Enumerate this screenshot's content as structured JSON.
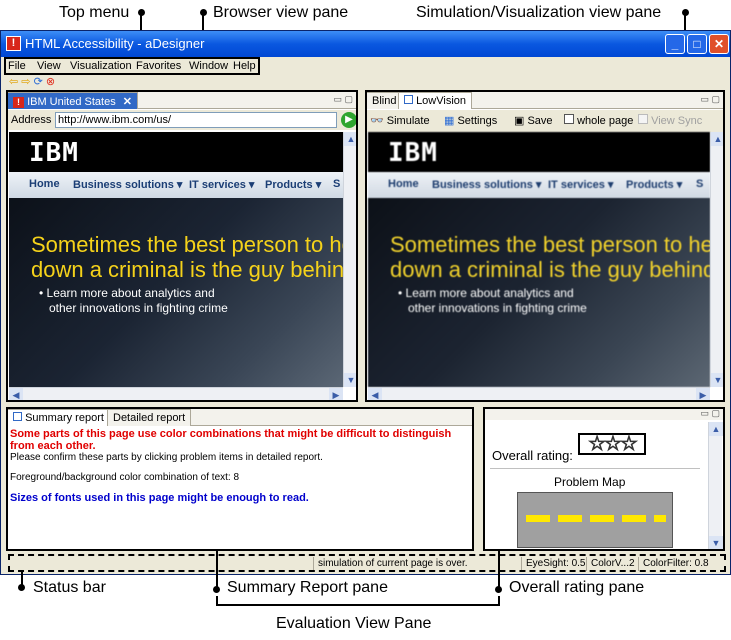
{
  "callouts": {
    "top_menu": "Top menu",
    "browser_view_pane": "Browser view pane",
    "simulation_view_pane": "Simulation/Visualization view pane",
    "status_bar": "Status bar",
    "summary_report_pane": "Summary Report pane",
    "overall_rating_pane": "Overall rating pane",
    "evaluation_view_pane": "Evaluation View Pane"
  },
  "window": {
    "title": "HTML Accessibility - aDesigner",
    "controls": {
      "minimize": "_",
      "maximize": "□",
      "close": "✕"
    }
  },
  "menu": [
    "File",
    "View",
    "Visualization",
    "Favorites",
    "Window",
    "Help"
  ],
  "browser": {
    "nav_icons": [
      "back-arrow-icon",
      "forward-arrow-icon",
      "refresh-icon",
      "stop-icon"
    ],
    "tab_label": "IBM United States",
    "tab_close": "✕",
    "address_label": "Address",
    "address_value": "http://www.ibm.com/us/",
    "go_icon": "go-icon"
  },
  "web_page": {
    "logo": "IBM",
    "nav": [
      "Home",
      "Business solutions ▾",
      "IT services ▾",
      "Products ▾",
      "S"
    ],
    "headline_line1": "Sometimes the best person to help",
    "headline_line2": "down a criminal is the guy behind t",
    "sub_line1": "• Learn more about analytics and",
    "sub_line2": "other innovations in fighting crime"
  },
  "simulation": {
    "tabs": [
      "Blind",
      "LowVision"
    ],
    "toolbar": {
      "simulate": "Simulate",
      "settings": "Settings",
      "save": "Save",
      "whole_page": "whole page",
      "view_sync": "View Sync"
    }
  },
  "report": {
    "tabs": [
      "Summary report",
      "Detailed report"
    ],
    "red_text": "Some parts of this page use color combinations that might be difficult to distinguish from each other.",
    "confirm_text": "Please confirm these parts by clicking problem items in detailed report.",
    "fg_bg_text": "Foreground/background color combination of text: 8",
    "blue_text": "Sizes of fonts used in this page might be enough to read."
  },
  "rating": {
    "label": "Overall rating:",
    "stars": 3,
    "stars_glyph": "☆☆☆",
    "problem_map": "Problem Map"
  },
  "status": {
    "message": "simulation of current page is over.",
    "eyesight": "EyeSight: 0.5",
    "colorv": "ColorV...2",
    "colorfilter": "ColorFilter: 0.8"
  },
  "colors": {
    "title_bar": "#0a58e0",
    "headline": "#f5d21a",
    "problem_highlight": "#ffe800",
    "red_text": "#e00000",
    "blue_text": "#0000cc"
  }
}
